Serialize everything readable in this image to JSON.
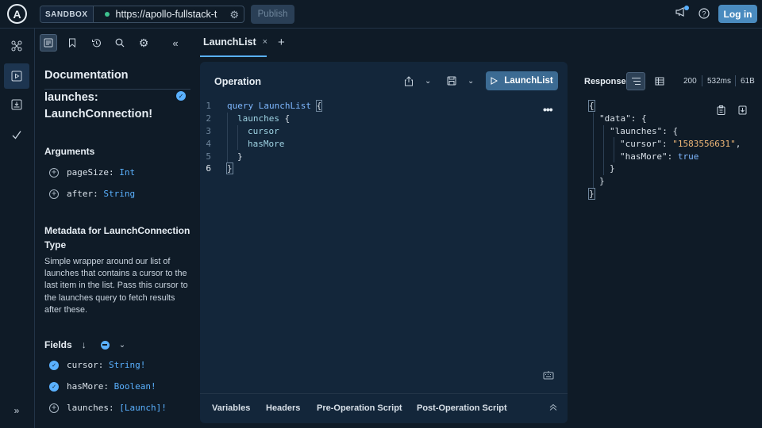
{
  "topbar": {
    "logo_letter": "A",
    "environment_label": "SANDBOX",
    "url": "https://apollo-fullstack-t",
    "publish_label": "Publish",
    "login_label": "Log in"
  },
  "docs_panel": {
    "title": "Documentation",
    "field_path": "launches:",
    "field_type": "LaunchConnection!",
    "arguments_heading": "Arguments",
    "arguments": [
      {
        "name": "pageSize:",
        "type": "Int"
      },
      {
        "name": "after:",
        "type": "String"
      }
    ],
    "metadata_heading": "Metadata for LaunchConnection Type",
    "metadata_description": "Simple wrapper around our list of launches that contains a cursor to the last item in the list. Pass this cursor to the launches query to fetch results after these.",
    "fields_heading": "Fields",
    "fields": [
      {
        "name": "cursor:",
        "type": "String!",
        "selected": true
      },
      {
        "name": "hasMore:",
        "type": "Boolean!",
        "selected": true
      },
      {
        "name": "launches:",
        "type": "[Launch]!",
        "selected": false
      }
    ]
  },
  "tabs": [
    {
      "label": "LaunchList",
      "close": "×"
    }
  ],
  "tab_add": "+",
  "operation": {
    "title": "Operation",
    "run_label": "LaunchList",
    "more": "•••",
    "line_numbers": [
      "1",
      "2",
      "3",
      "4",
      "5",
      "6"
    ],
    "code": {
      "kw_query": "query",
      "op_name": "LaunchList",
      "open_brace": "{",
      "launches": "launches",
      "cursor": "cursor",
      "hasMore": "hasMore",
      "close_brace": "}"
    },
    "footer_tabs": [
      "Variables",
      "Headers",
      "Pre-Operation Script",
      "Post-Operation Script"
    ]
  },
  "response": {
    "title": "Response",
    "status": "200",
    "time": "532ms",
    "size": "61B",
    "json": {
      "data_key": "\"data\"",
      "launches_key": "\"launches\"",
      "cursor_key": "\"cursor\"",
      "cursor_value": "\"1583556631\"",
      "hasmore_key": "\"hasMore\"",
      "hasmore_value": "true"
    }
  },
  "icons": {
    "doc": "document-icon",
    "bookmark": "bookmark-icon",
    "history": "history-icon",
    "search": "search-icon",
    "settings": "gear-icon",
    "collapse": "double-chevron-left-icon"
  },
  "colors": {
    "background": "#0f1b27",
    "panel": "#13263a",
    "accent": "#5ab1ff",
    "run_button": "#3c6b93",
    "login_button": "#4a8bbf",
    "string_value": "#f0b878"
  }
}
